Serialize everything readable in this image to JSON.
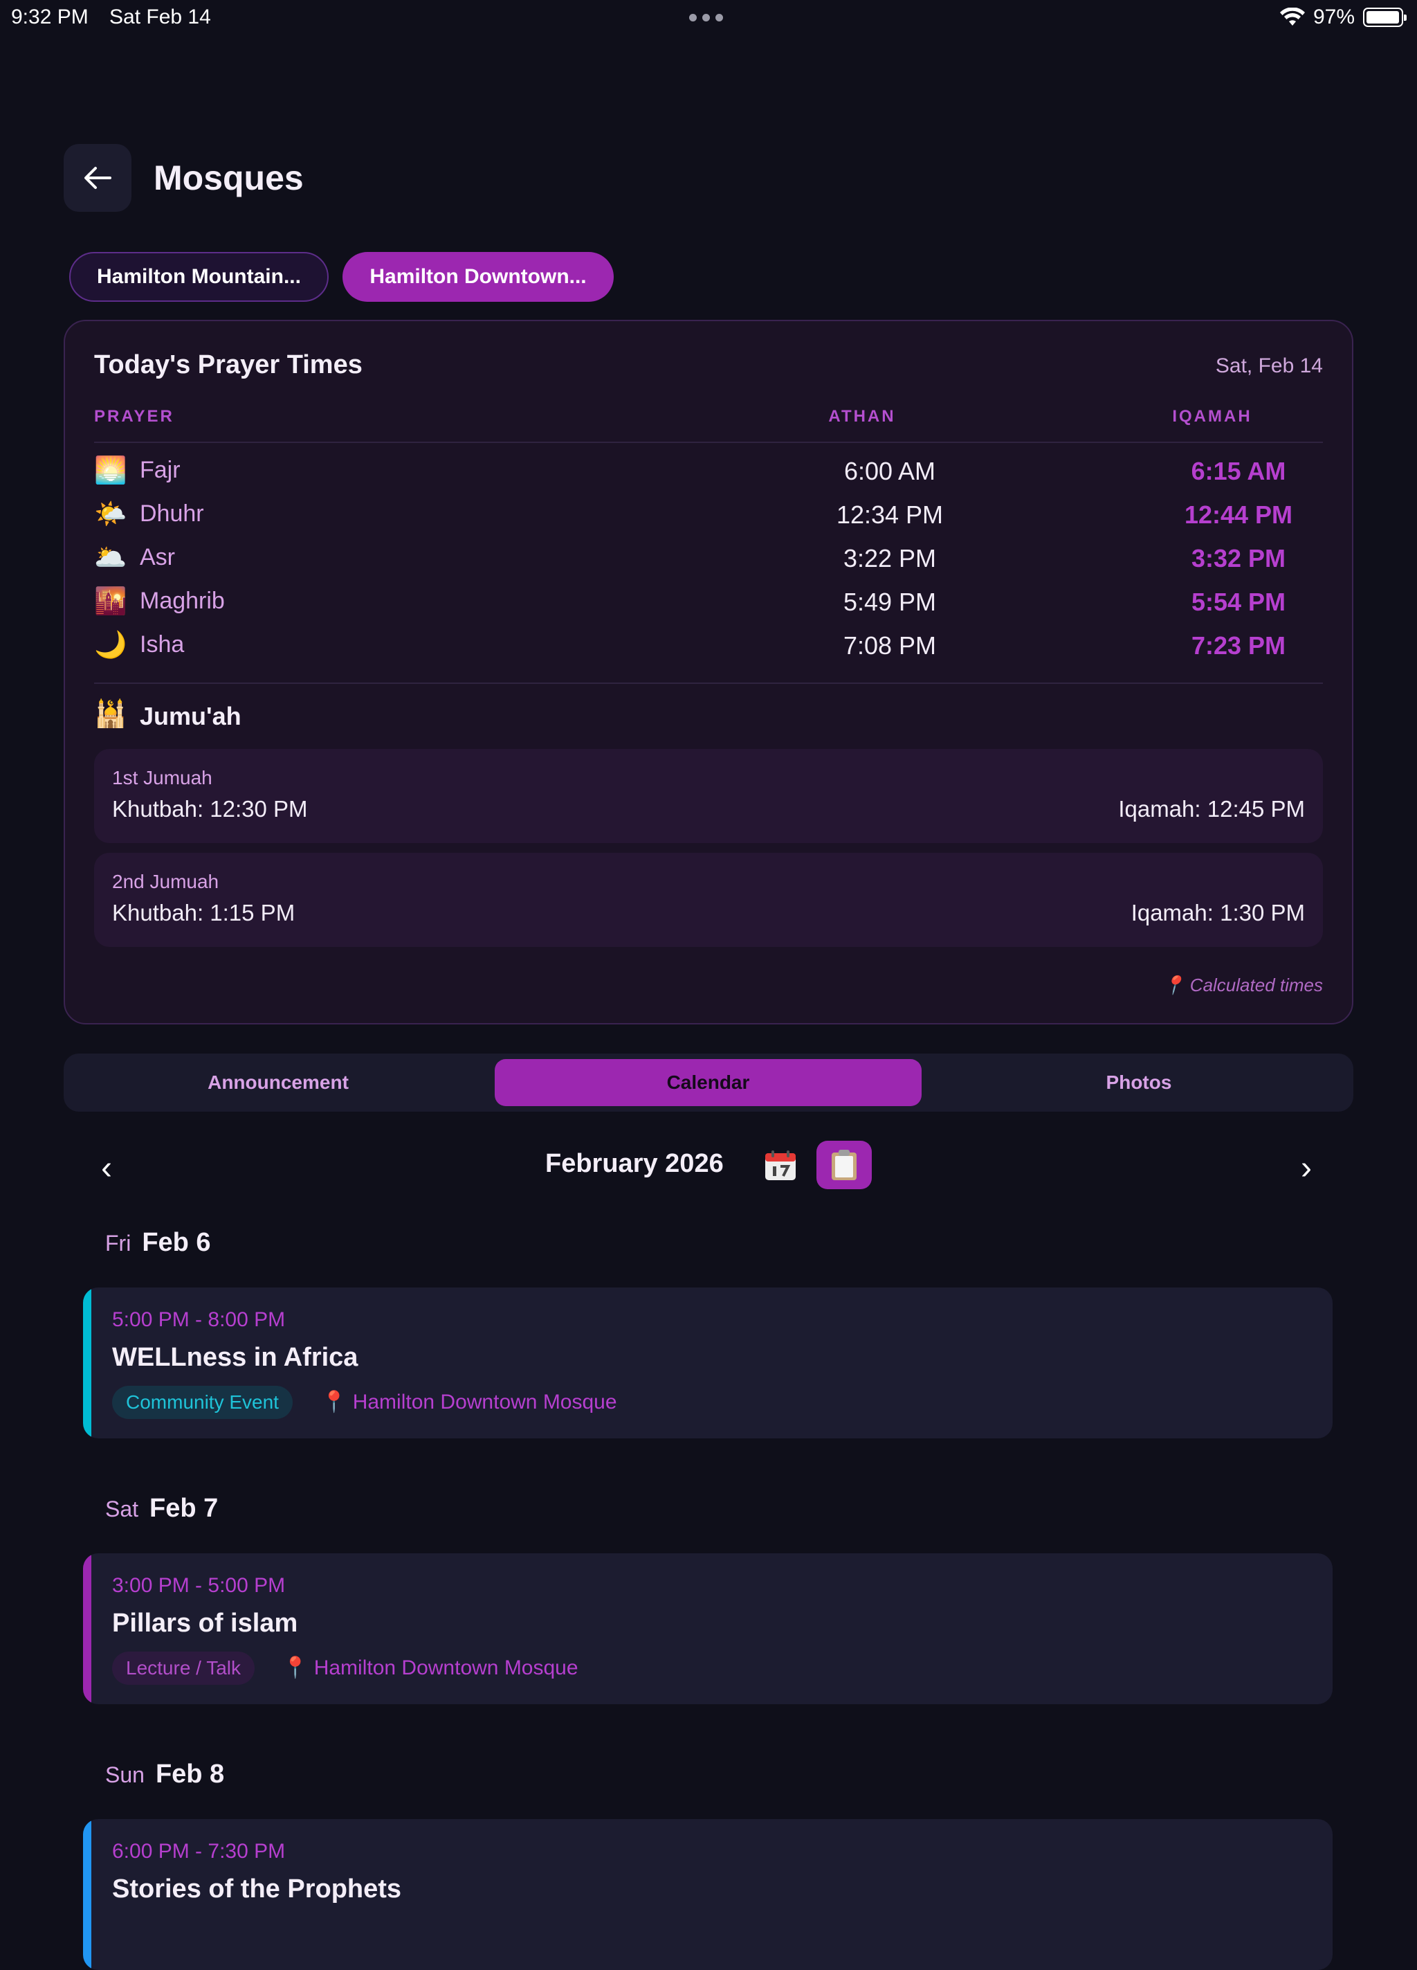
{
  "status_bar": {
    "time": "9:32 PM",
    "date": "Sat Feb 14",
    "battery": "97%",
    "battery_level": 0.97
  },
  "header": {
    "title": "Mosques"
  },
  "mosque_chips": [
    {
      "label": "Hamilton Mountain..."
    },
    {
      "label": "Hamilton Downtown..."
    }
  ],
  "prayer_card": {
    "title": "Today's Prayer Times",
    "date": "Sat, Feb 14",
    "columns": {
      "prayer": "PRAYER",
      "athan": "ATHAN",
      "iqamah": "IQAMAH"
    },
    "prayers": [
      {
        "icon": "🌅",
        "icon_name": "sunrise-icon",
        "name": "Fajr",
        "athan": "6:00 AM",
        "iqamah": "6:15 AM"
      },
      {
        "icon": "🌤️",
        "icon_name": "sun-cloud-icon",
        "name": "Dhuhr",
        "athan": "12:34 PM",
        "iqamah": "12:44 PM"
      },
      {
        "icon": "🌥️",
        "icon_name": "cloud-sun-icon",
        "name": "Asr",
        "athan": "3:22 PM",
        "iqamah": "3:32 PM"
      },
      {
        "icon": "🌇",
        "icon_name": "sunset-icon",
        "name": "Maghrib",
        "athan": "5:49 PM",
        "iqamah": "5:54 PM"
      },
      {
        "icon": "🌙",
        "icon_name": "crescent-moon-icon",
        "name": "Isha",
        "athan": "7:08 PM",
        "iqamah": "7:23 PM"
      }
    ],
    "jumuah": {
      "title": "Jumu'ah",
      "icon": "🕌",
      "sessions": [
        {
          "label": "1st Jumuah",
          "khutbah": "Khutbah: 12:30 PM",
          "iqamah": "Iqamah: 12:45 PM"
        },
        {
          "label": "2nd Jumuah",
          "khutbah": "Khutbah: 1:15 PM",
          "iqamah": "Iqamah: 1:30 PM"
        }
      ]
    },
    "note": "Calculated times"
  },
  "tabs": [
    {
      "label": "Announcement"
    },
    {
      "label": "Calendar"
    },
    {
      "label": "Photos"
    }
  ],
  "calendar": {
    "month_label": "February 2026",
    "prev_arrow": "‹",
    "next_arrow": "›",
    "days": [
      {
        "dow": "Fri",
        "date": "Feb 6",
        "event": {
          "time": "5:00 PM - 8:00 PM",
          "title": "WELLness in Africa",
          "tag": "Community Event",
          "location": "Hamilton Downtown Mosque",
          "color": "#00bcd4"
        }
      },
      {
        "dow": "Sat",
        "date": "Feb 7",
        "event": {
          "time": "3:00 PM - 5:00 PM",
          "title": "Pillars of islam",
          "tag": "Lecture / Talk",
          "location": "Hamilton Downtown Mosque",
          "color": "#9c27b0"
        }
      },
      {
        "dow": "Sun",
        "date": "Feb 8",
        "event": {
          "time": "6:00 PM - 7:30 PM",
          "title": "Stories of the Prophets",
          "color": "#2196f3"
        }
      }
    ]
  },
  "colors": {
    "accent": "#9c27b0",
    "background": "#0f0f1a",
    "card": "#1b1225"
  }
}
